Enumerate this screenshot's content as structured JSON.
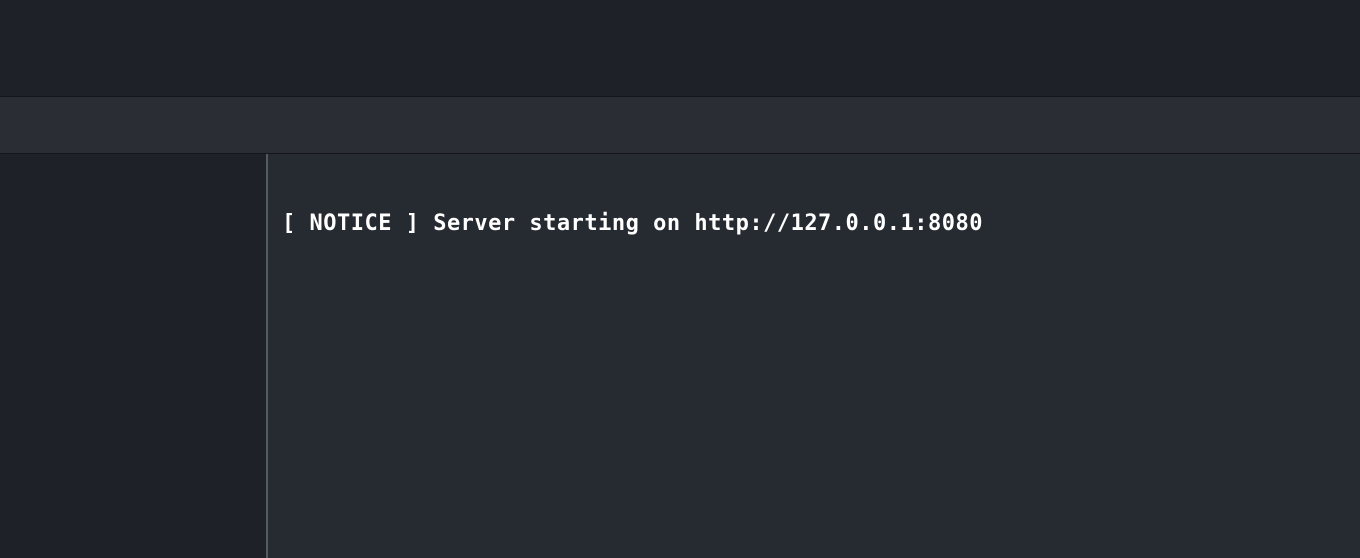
{
  "console": {
    "lines": [
      "[ NOTICE ] Server starting on http://127.0.0.1:8080"
    ]
  }
}
